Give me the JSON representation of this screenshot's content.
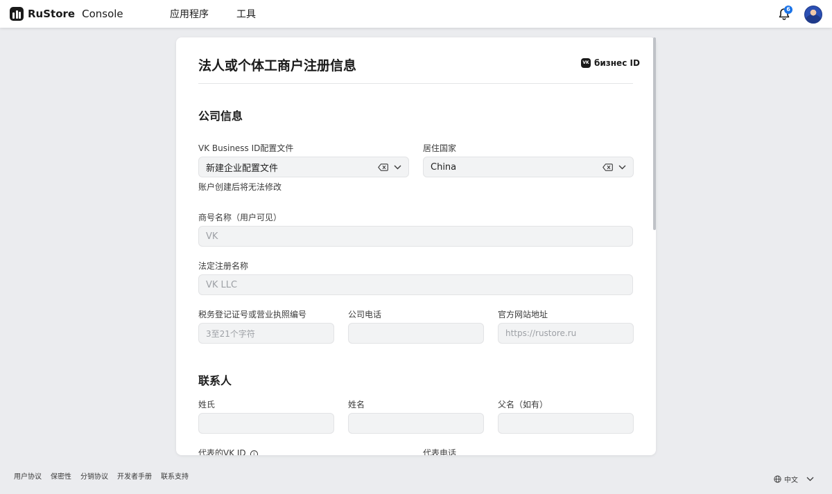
{
  "header": {
    "brand": "RuStore",
    "brand_sub": "Console",
    "nav": [
      "应用程序",
      "工具"
    ],
    "notification_count": "6"
  },
  "card": {
    "title": "法人或个体工商户注册信息",
    "vk_business": "бизнес ID"
  },
  "company": {
    "section_title": "公司信息",
    "vk_profile_label": "VK Business ID配置文件",
    "vk_profile_value": "新建企业配置文件",
    "vk_profile_hint": "账户创建后将无法修改",
    "country_label": "居住国家",
    "country_value": "China",
    "trade_name_label": "商号名称（用户可见）",
    "trade_name_placeholder": "VK",
    "legal_name_label": "法定注册名称",
    "legal_name_placeholder": "VK LLC",
    "tax_id_label": "税务登记证号或营业执照编号",
    "tax_id_placeholder": "3至21个字符",
    "phone_label": "公司电话",
    "phone_placeholder": "",
    "website_label": "官方网站地址",
    "website_placeholder": "https://rustore.ru"
  },
  "contact": {
    "section_title": "联系人",
    "surname_label": "姓氏",
    "given_name_label": "姓名",
    "patronymic_label": "父名（如有）",
    "vk_id_label": "代表的VK ID",
    "rep_phone_label": "代表电话"
  },
  "footer": {
    "links": [
      "用户协议",
      "保密性",
      "分销协议",
      "开发者手册",
      "联系支持"
    ],
    "language": "中文"
  },
  "colors": {
    "page_bg": "#ebecef",
    "field_bg": "#f2f3f4",
    "badge": "#1a73e8",
    "text": "#1a1a1a"
  }
}
